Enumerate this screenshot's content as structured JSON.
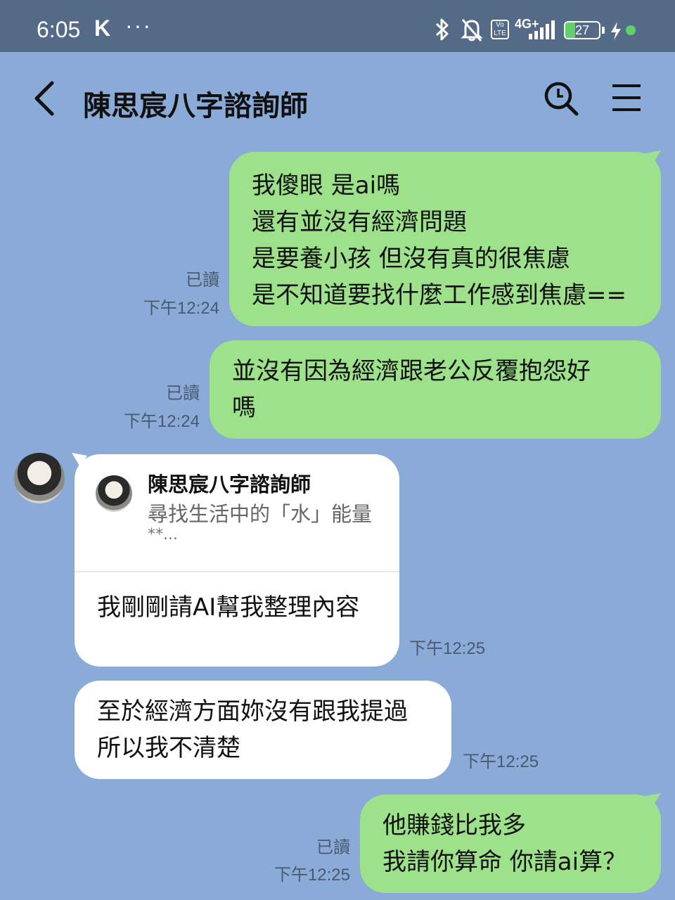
{
  "status": {
    "time": "6:05",
    "k_label": "K",
    "dots": "···",
    "network": "4G+",
    "volte": "Vo LTE",
    "battery": "27"
  },
  "header": {
    "title": "陳思宸八字諮詢師"
  },
  "messages": [
    {
      "lines": [
        "我傻眼 是ai嗎",
        "還有並沒有經濟問題",
        "是要養小孩 但沒有真的很焦慮",
        "是不知道要找什麼工作感到焦慮=="
      ],
      "read": "已讀",
      "time": "下午12:24"
    },
    {
      "lines": [
        "並沒有因為經濟跟老公反覆抱怨好",
        "嗎"
      ],
      "read": "已讀",
      "time": "下午12:24"
    },
    {
      "card_name": "陳思宸八字諮詢師",
      "card_desc": "尋找生活中的「水」能量",
      "card_desc2": "**...",
      "body": "我剛剛請AI幫我整理內容",
      "time": "下午12:25"
    },
    {
      "lines": [
        "至於經濟方面妳沒有跟我提過",
        "所以我不清楚"
      ],
      "time": "下午12:25"
    },
    {
      "lines": [
        "他賺錢比我多",
        "我請你算命 你請ai算？"
      ],
      "read": "已讀",
      "time": "下午12:25"
    }
  ]
}
